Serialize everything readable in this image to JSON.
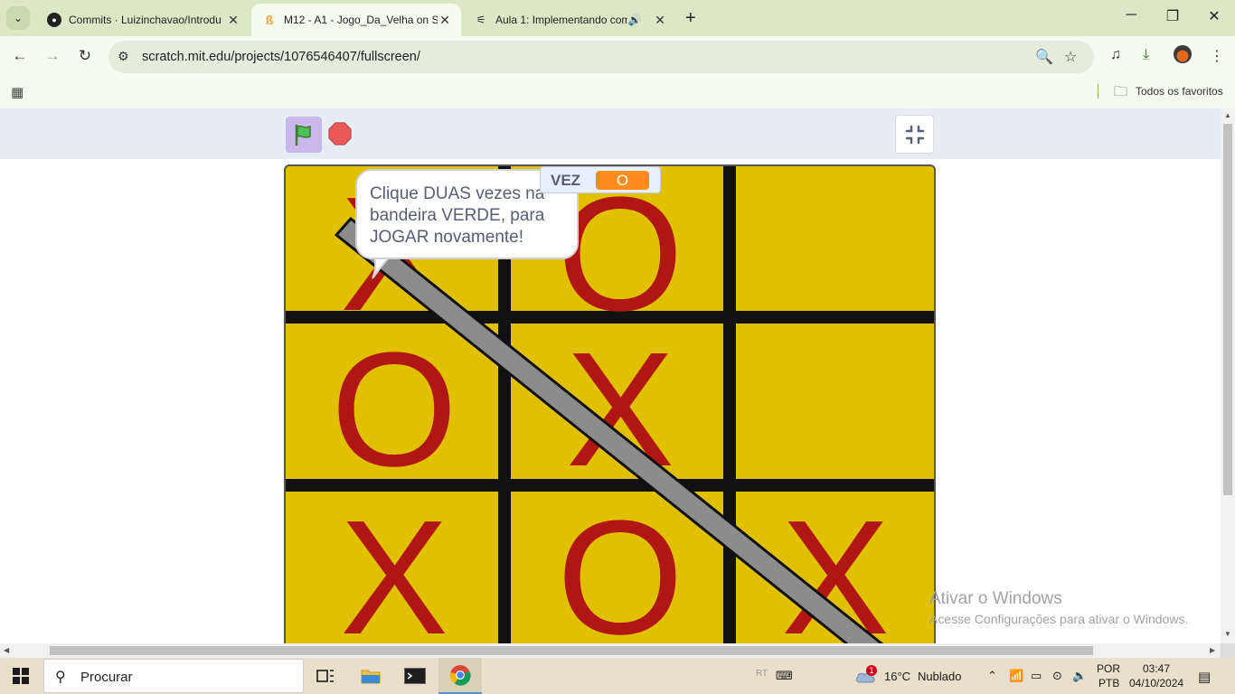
{
  "browser": {
    "tabs": [
      {
        "title": "Commits · Luizinchavao/Introdu",
        "icon": "github-icon",
        "active": false
      },
      {
        "title": "M12 - A1 - Jogo_Da_Velha on S",
        "icon": "scratch-icon",
        "active": true
      },
      {
        "title": "Aula 1: Implementando com",
        "icon": "aula-icon",
        "active": false
      }
    ],
    "url": "scratch.mit.edu/projects/1076546407/fullscreen/",
    "bookmarks_label": "Todos os favoritos"
  },
  "scratch": {
    "speech_bubble": "Clique DUAS vezes na bandeira VERDE, para JOGAR novamente!",
    "monitor": {
      "label": "VEZ",
      "value": "O"
    },
    "board": {
      "rows": [
        [
          "X",
          "O",
          ""
        ],
        [
          "O",
          "X",
          ""
        ],
        [
          "X",
          "O",
          "X"
        ]
      ],
      "win_line": "diagonal top-left to bottom-right"
    },
    "colors": {
      "stage_bg": "#e1c000",
      "mark": "#b01712",
      "grid": "#111111",
      "win_line": "#8c8c8c",
      "monitor_value_bg": "#ff8c1a"
    }
  },
  "watermark": {
    "title": "Ativar o Windows",
    "subtitle": "Acesse Configurações para ativar o Windows."
  },
  "taskbar": {
    "search_placeholder": "Procurar",
    "weather": {
      "temp": "16°C",
      "condition": "Nublado",
      "alerts": "1"
    },
    "lang_top": "POR",
    "lang_bottom": "PTB",
    "time": "03:47",
    "date": "04/10/2024"
  }
}
